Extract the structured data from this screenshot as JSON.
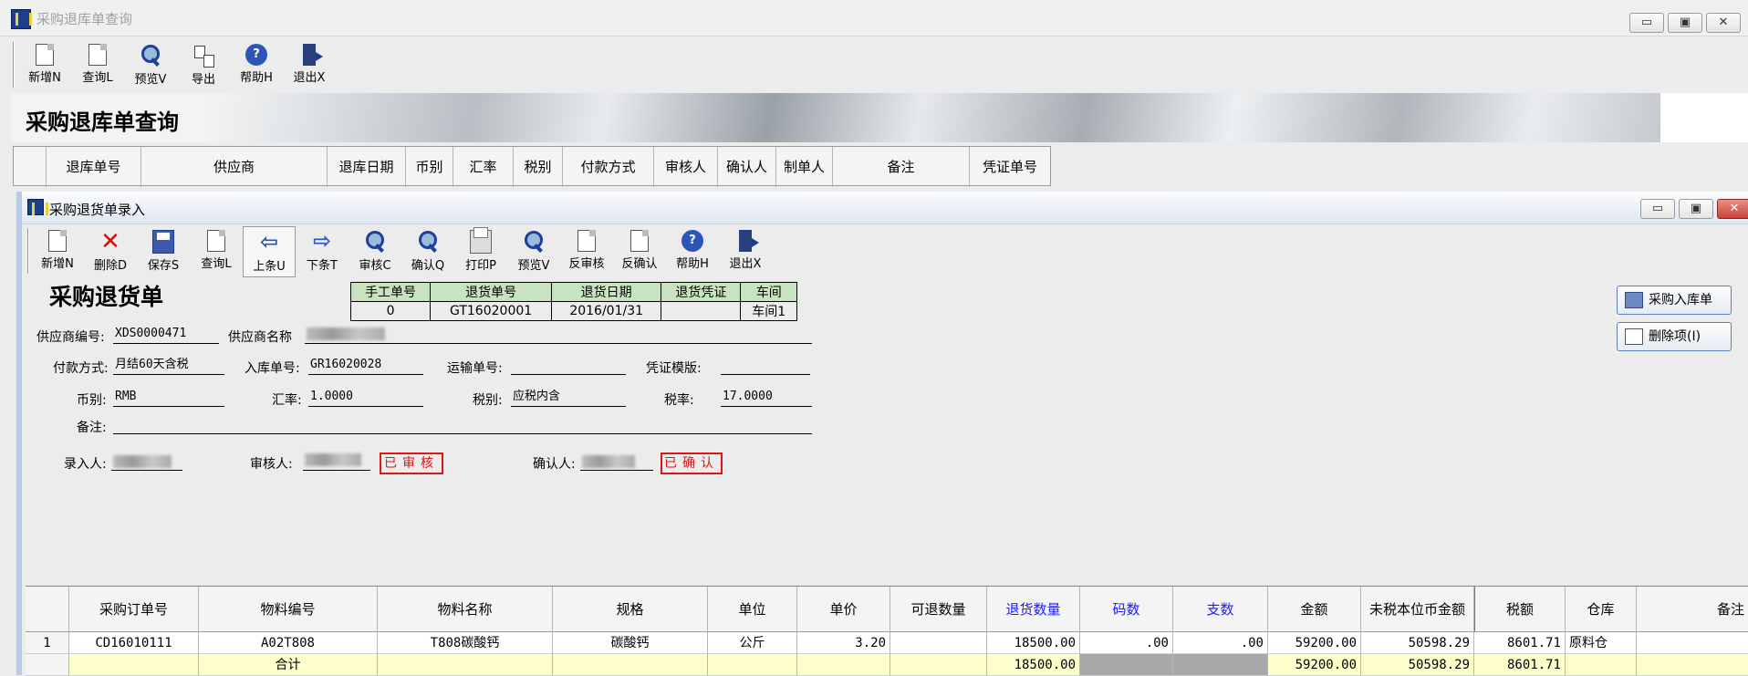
{
  "outer": {
    "title": "采购退库单查询",
    "toolbar": [
      "新增N",
      "查询L",
      "预览V",
      "导出",
      "帮助H",
      "退出X"
    ],
    "banner_title": "采购退库单查询",
    "columns": [
      "退库单号",
      "供应商",
      "退库日期",
      "币别",
      "汇率",
      "税别",
      "付款方式",
      "审核人",
      "确认人",
      "制单人",
      "备注",
      "凭证单号"
    ]
  },
  "inner": {
    "title": "采购退货单录入",
    "toolbar": [
      "新增N",
      "删除D",
      "保存S",
      "查询L",
      "上条U",
      "下条T",
      "审核C",
      "确认Q",
      "打印P",
      "预览V",
      "反审核",
      "反确认",
      "帮助H",
      "退出X"
    ],
    "form_title": "采购退货单",
    "hdr_table": {
      "headers": [
        "手工单号",
        "退货单号",
        "退货日期",
        "退货凭证",
        "车间"
      ],
      "values": [
        "0",
        "GT16020001",
        "2016/01/31",
        "",
        "车间1"
      ]
    },
    "fields": {
      "supplier_code_label": "供应商编号:",
      "supplier_code": "XDS0000471",
      "supplier_name_label": "供应商名称",
      "payment_label": "付款方式:",
      "payment": "月结60天含税",
      "inbound_no_label": "入库单号:",
      "inbound_no": "GR16020028",
      "transport_label": "运输单号:",
      "transport": "",
      "voucher_tpl_label": "凭证模版:",
      "voucher_tpl": "",
      "currency_label": "币别:",
      "currency": "RMB",
      "rate_label": "汇率:",
      "rate": "1.0000",
      "tax_type_label": "税别:",
      "tax_type": "应税内含",
      "tax_rate_label": "税率:",
      "tax_rate": "17.0000",
      "remark_label": "备注:",
      "remark": "",
      "entered_by_label": "录入人:",
      "reviewer_label": "审核人:",
      "confirmer_label": "确认人:"
    },
    "stamps": {
      "reviewed": "已审核",
      "confirmed": "已确认"
    },
    "side_buttons": {
      "inbound": "采购入库单",
      "delete_item": "删除项(I)"
    },
    "detail": {
      "columns": [
        "采购订单号",
        "物料编号",
        "物料名称",
        "规格",
        "单位",
        "单价",
        "可退数量",
        "退货数量",
        "码数",
        "支数",
        "金额",
        "未税本位币金额",
        "税额",
        "仓库",
        "备注"
      ],
      "rows": [
        {
          "idx": "1",
          "po": "CD16010111",
          "item_code": "A02T808",
          "item_name": "T808碳酸钙",
          "spec": "碳酸钙",
          "unit": "公斤",
          "price": "3.20",
          "returnable": "",
          "qty": "18500.00",
          "size": ".00",
          "pieces": ".00",
          "amount": "59200.00",
          "pretax": "50598.29",
          "tax": "8601.71",
          "warehouse": "原料仓",
          "remark": ""
        }
      ],
      "total": {
        "label": "合计",
        "qty": "18500.00",
        "amount": "59200.00",
        "pretax": "50598.29",
        "tax": "8601.71"
      }
    }
  }
}
